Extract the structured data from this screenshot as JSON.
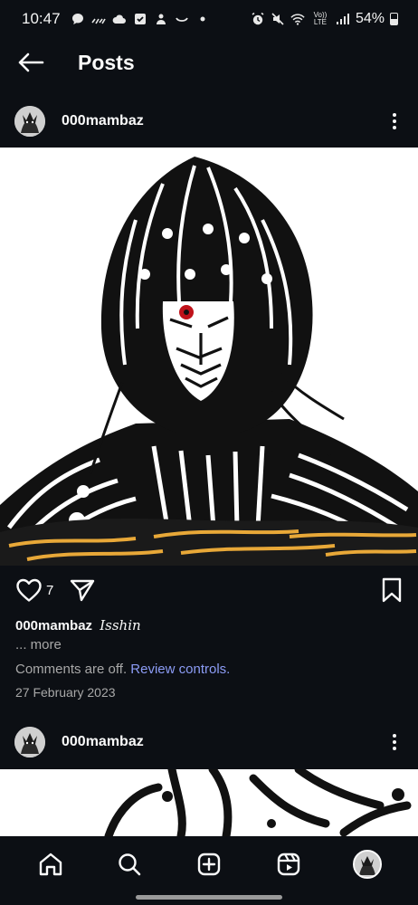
{
  "status_bar": {
    "time": "10:47",
    "battery": "54%",
    "network": "Vo)) LTE",
    "icons_left": [
      "chat-bubble-icon",
      "signal-squiggle-icon",
      "cloud-icon",
      "checkbox-icon",
      "person-icon",
      "smile-icon",
      "dot-icon"
    ],
    "icons_right": [
      "alarm-icon",
      "mute-icon",
      "wifi-icon",
      "cell-signal-icon",
      "battery-icon"
    ]
  },
  "header": {
    "title": "Posts"
  },
  "posts": [
    {
      "username": "000mambaz",
      "likes": "7",
      "caption_user": "000mambaz",
      "caption_text": "Isshin",
      "more": "... more",
      "comments_off": "Comments are off.",
      "review_controls": "Review controls.",
      "date": "27 February 2023"
    },
    {
      "username": "000mambaz"
    }
  ],
  "nav": {
    "items": [
      "home-icon",
      "search-icon",
      "create-icon",
      "reels-icon",
      "profile-avatar"
    ]
  },
  "colors": {
    "background": "#0c0f14",
    "text": "#fafafa",
    "muted": "#a8a8a8",
    "link": "#8c9cf5",
    "image_accent": "#e8a838"
  }
}
